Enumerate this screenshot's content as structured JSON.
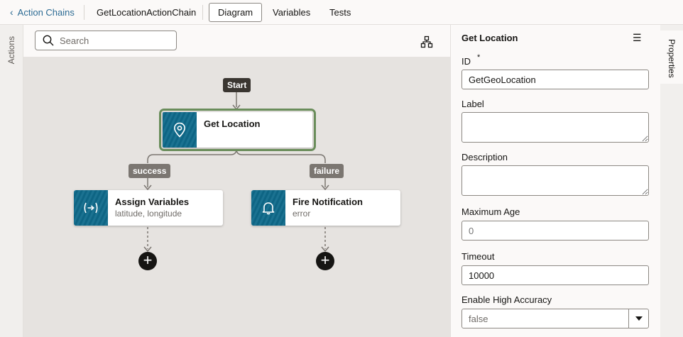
{
  "header": {
    "back_label": "Action Chains",
    "chain_name": "GetLocationActionChain",
    "tabs": [
      {
        "label": "Diagram",
        "active": true
      },
      {
        "label": "Variables",
        "active": false
      },
      {
        "label": "Tests",
        "active": false
      }
    ]
  },
  "left_rail": {
    "label": "Actions"
  },
  "canvas": {
    "search_placeholder": "Search",
    "start_label": "Start",
    "root_node": {
      "title": "Get Location",
      "icon": "location-pin-icon"
    },
    "branches": [
      {
        "label": "success",
        "node_title": "Assign Variables",
        "node_subtitle": "latitude, longitude",
        "icon": "assign-variables-icon"
      },
      {
        "label": "failure",
        "node_title": "Fire Notification",
        "node_subtitle": "error",
        "icon": "bell-icon"
      }
    ]
  },
  "properties": {
    "title": "Get Location",
    "id_label": "ID",
    "required_mark": "*",
    "id_value": "GetGeoLocation",
    "label_label": "Label",
    "label_value": "",
    "description_label": "Description",
    "description_value": "",
    "max_age_label": "Maximum Age",
    "max_age_placeholder": "0",
    "timeout_label": "Timeout",
    "timeout_value": "10000",
    "accuracy_label": "Enable High Accuracy",
    "accuracy_value": "false"
  },
  "right_rail": {
    "label": "Properties"
  },
  "colors": {
    "accent_link": "#2c6b94",
    "node_icon_bg": "#0f6a8b",
    "selected_outline": "#6a8d5b",
    "pill_dark": "#3a3631",
    "pill_gray": "#7b7671"
  }
}
